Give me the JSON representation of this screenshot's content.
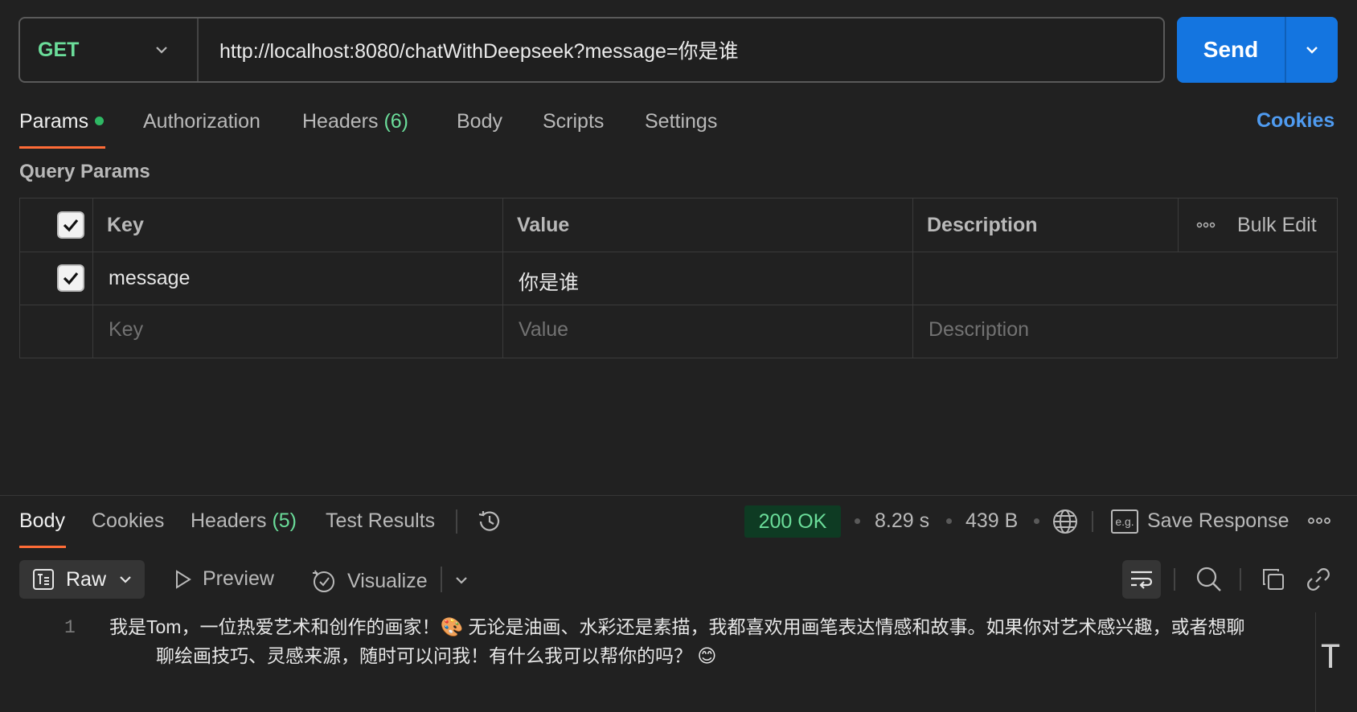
{
  "request": {
    "method": "GET",
    "url": "http://localhost:8080/chatWithDeepseek?message=你是谁",
    "send_label": "Send"
  },
  "request_tabs": [
    {
      "label": "Params",
      "active": true
    },
    {
      "label": "Authorization"
    },
    {
      "label": "Headers",
      "count": "(6)"
    },
    {
      "label": "Body"
    },
    {
      "label": "Scripts"
    },
    {
      "label": "Settings"
    }
  ],
  "cookies_link": "Cookies",
  "query_params": {
    "title": "Query Params",
    "headers": {
      "key": "Key",
      "value": "Value",
      "description": "Description",
      "bulk_edit": "Bulk Edit"
    },
    "rows": [
      {
        "checked": true,
        "key": "message",
        "value": "你是谁",
        "description": ""
      }
    ],
    "placeholders": {
      "key": "Key",
      "value": "Value",
      "description": "Description"
    }
  },
  "response_tabs": [
    {
      "label": "Body",
      "active": true
    },
    {
      "label": "Cookies"
    },
    {
      "label": "Headers",
      "count": "(5)"
    },
    {
      "label": "Test Results"
    }
  ],
  "response_meta": {
    "status": "200 OK",
    "time": "8.29 s",
    "size": "439 B",
    "save_response": "Save Response",
    "eg_label": "e.g."
  },
  "response_toolbar": {
    "format": "Raw",
    "preview": "Preview",
    "visualize": "Visualize"
  },
  "response_body": {
    "line_number": "1",
    "line1": "我是Tom，一位热爱艺术和创作的画家！🎨 无论是油画、水彩还是素描，我都喜欢用画笔表达情感和故事。如果你对艺术感兴趣，或者想聊",
    "line2": "聊绘画技巧、灵感来源，随时可以问我！有什么我可以帮你的吗？ 😊"
  },
  "colors": {
    "accent_orange": "#ff6c37",
    "send_blue": "#1475e0",
    "method_green": "#6bdd9a",
    "link_blue": "#4f9bf0"
  }
}
